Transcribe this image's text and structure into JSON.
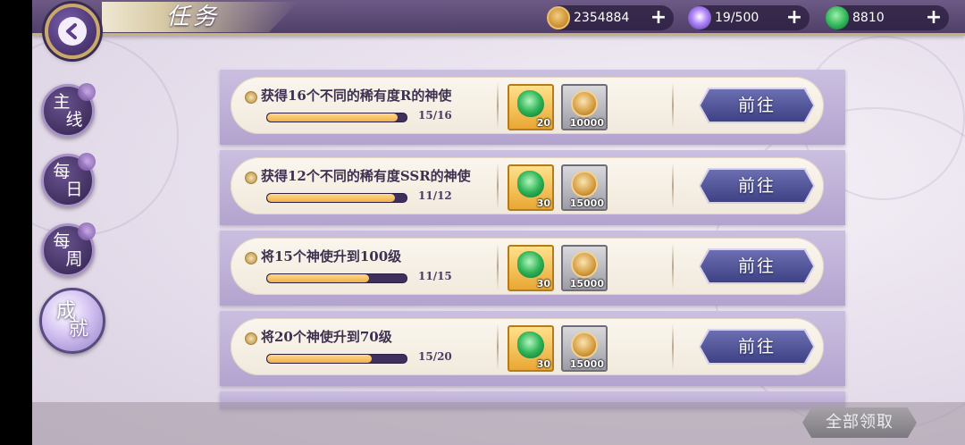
{
  "header": {
    "title": "任务",
    "currencies": [
      {
        "icon": "gold-coin-icon",
        "value": "2354884"
      },
      {
        "icon": "energy-orb-icon",
        "value": "19/500"
      },
      {
        "icon": "jade-magatama-icon",
        "value": "8810"
      }
    ]
  },
  "sidebar": {
    "tabs": [
      {
        "label1": "主",
        "label2": "线",
        "active": false
      },
      {
        "label1": "每",
        "label2": "日",
        "active": false
      },
      {
        "label1": "每",
        "label2": "周",
        "active": false
      },
      {
        "label1": "成",
        "label2": "就",
        "active": true
      }
    ]
  },
  "tasks": [
    {
      "title": "获得16个不同的稀有度R的神使",
      "progress_text": "15/16",
      "progress": 0.9375,
      "rewards": [
        {
          "type": "jade",
          "icon": "jade-magatama-icon",
          "count": "20"
        },
        {
          "type": "coin",
          "icon": "gold-coin-icon",
          "count": "10000"
        }
      ],
      "button": "前往"
    },
    {
      "title": "获得12个不同的稀有度SSR的神使",
      "progress_text": "11/12",
      "progress": 0.9167,
      "rewards": [
        {
          "type": "jade",
          "icon": "jade-magatama-icon",
          "count": "30"
        },
        {
          "type": "coin",
          "icon": "gold-coin-icon",
          "count": "15000"
        }
      ],
      "button": "前往"
    },
    {
      "title": "将15个神使升到100级",
      "progress_text": "11/15",
      "progress": 0.7333,
      "rewards": [
        {
          "type": "jade",
          "icon": "jade-magatama-icon",
          "count": "30"
        },
        {
          "type": "coin",
          "icon": "gold-coin-icon",
          "count": "15000"
        }
      ],
      "button": "前往"
    },
    {
      "title": "将20个神使升到70级",
      "progress_text": "15/20",
      "progress": 0.75,
      "rewards": [
        {
          "type": "jade",
          "icon": "jade-magatama-icon",
          "count": "30"
        },
        {
          "type": "coin",
          "icon": "gold-coin-icon",
          "count": "15000"
        }
      ],
      "button": "前往"
    }
  ],
  "footer": {
    "claim_all": "全部领取"
  },
  "colors": {
    "header_bg": "#4d3d66",
    "progress_fill": "#f0b14a",
    "go_button": "#3e4285"
  }
}
